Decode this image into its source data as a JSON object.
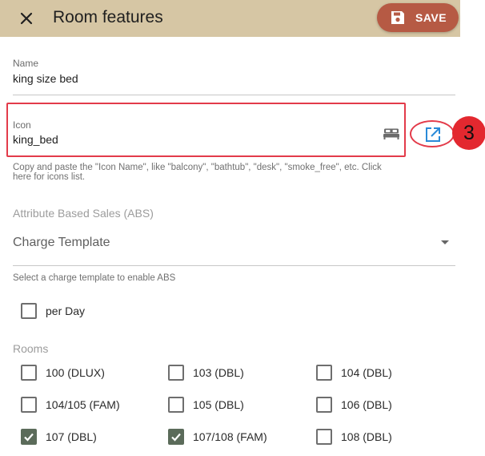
{
  "header": {
    "title": "Room features",
    "save_label": "SAVE"
  },
  "name_field": {
    "label": "Name",
    "value": "king size bed"
  },
  "icon_field": {
    "label": "Icon",
    "value": "king_bed",
    "preview_icon": "king-bed-icon"
  },
  "icon_help": {
    "line1": "Copy and paste the \"Icon Name\", like \"balcony\", \"bathtub\", \"desk\", \"smoke_free\", etc. Click",
    "line2": "here for icons list."
  },
  "annotation": {
    "badge": "3"
  },
  "abs": {
    "section_label": "Attribute Based Sales (ABS)",
    "charge_template_placeholder": "Charge Template",
    "charge_template_help": "Select a charge template to enable ABS",
    "per_day_label": "per Day",
    "per_day_checked": false
  },
  "rooms": {
    "label": "Rooms",
    "items": [
      {
        "label": "100 (DLUX)",
        "checked": false
      },
      {
        "label": "103 (DBL)",
        "checked": false
      },
      {
        "label": "104 (DBL)",
        "checked": false
      },
      {
        "label": "104/105 (FAM)",
        "checked": false
      },
      {
        "label": "105 (DBL)",
        "checked": false
      },
      {
        "label": "106 (DBL)",
        "checked": false
      },
      {
        "label": "107 (DBL)",
        "checked": true
      },
      {
        "label": "107/108 (FAM)",
        "checked": true
      },
      {
        "label": "108 (DBL)",
        "checked": false
      }
    ]
  },
  "colors": {
    "appbar": "#d6c6a4",
    "save_button": "#b65a44",
    "highlight": "#e33b4a",
    "checkbox_checked": "#5b6b5a",
    "link_icon": "#2a8ad8"
  }
}
